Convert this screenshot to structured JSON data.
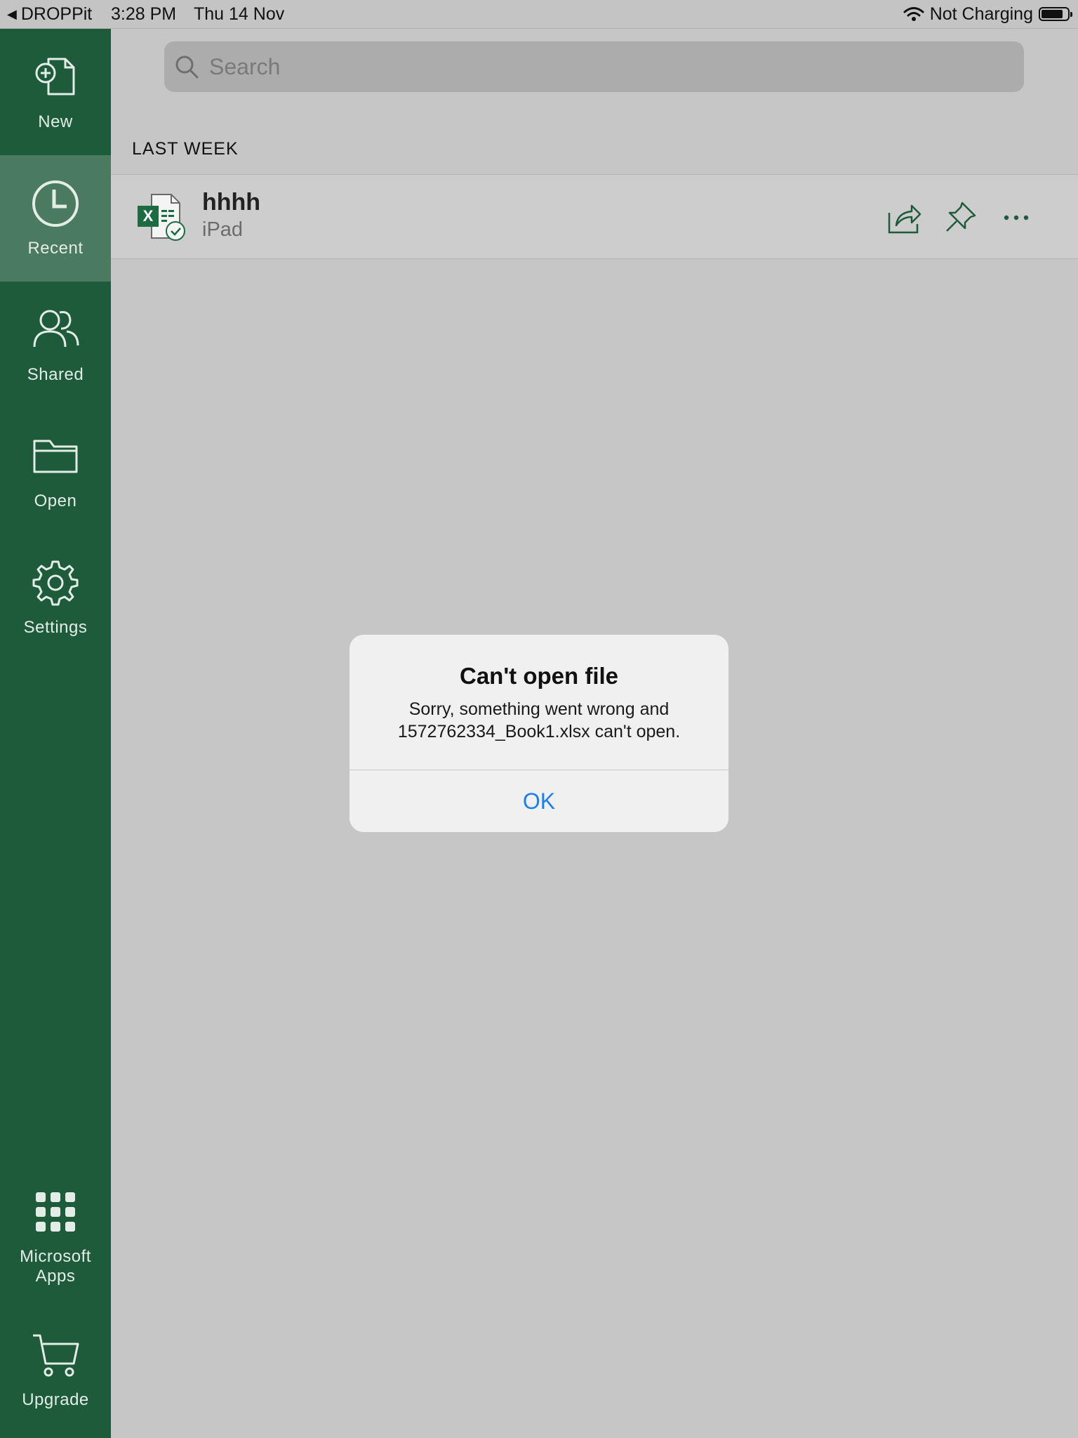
{
  "status_bar": {
    "back_app": "DROPPit",
    "time": "3:28 PM",
    "date": "Thu 14 Nov",
    "charging": "Not Charging"
  },
  "sidebar": {
    "items": [
      {
        "label": "New",
        "icon": "new-document-icon"
      },
      {
        "label": "Recent",
        "icon": "clock-icon",
        "active": true
      },
      {
        "label": "Shared",
        "icon": "people-icon"
      },
      {
        "label": "Open",
        "icon": "folder-icon"
      },
      {
        "label": "Settings",
        "icon": "gear-icon"
      },
      {
        "label": "Microsoft Apps",
        "icon": "apps-grid-icon"
      },
      {
        "label": "Upgrade",
        "icon": "cart-icon"
      }
    ]
  },
  "search": {
    "placeholder": "Search"
  },
  "recent": {
    "section_label": "LAST WEEK",
    "files": [
      {
        "name": "hhhh",
        "location": "iPad",
        "icon": "excel-file-icon"
      }
    ]
  },
  "alert": {
    "title": "Can't open file",
    "message": "Sorry, something went wrong and 1572762334_Book1.xlsx can't open.",
    "ok_label": "OK"
  },
  "colors": {
    "sidebar": "#1d5b3a",
    "sidebar_active": "#4a7a5f",
    "background": "#c6c6c6",
    "link_blue": "#1a7ff0"
  }
}
